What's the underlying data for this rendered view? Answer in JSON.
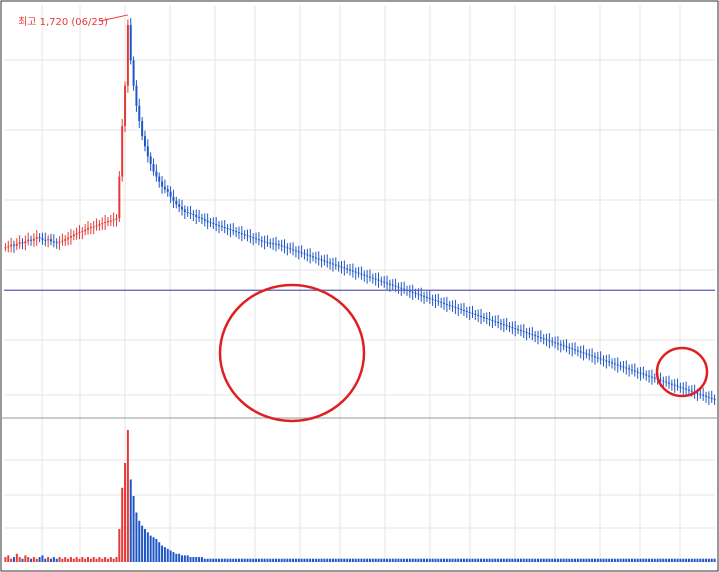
{
  "chart_data": {
    "type": "candlestick",
    "annotation": {
      "peak_label": "최고 1,720 (06/25)",
      "peak_index": 43
    },
    "series": {
      "closes": [
        1280,
        1282,
        1285,
        1283,
        1287,
        1290,
        1288,
        1292,
        1295,
        1293,
        1297,
        1300,
        1298,
        1295,
        1294,
        1296,
        1292,
        1290,
        1289,
        1291,
        1293,
        1296,
        1299,
        1302,
        1305,
        1308,
        1310,
        1312,
        1315,
        1318,
        1320,
        1321,
        1323,
        1326,
        1328,
        1330,
        1332,
        1333,
        1335,
        1338,
        1420,
        1520,
        1600,
        1720,
        1650,
        1600,
        1560,
        1530,
        1500,
        1480,
        1460,
        1445,
        1430,
        1420,
        1410,
        1400,
        1395,
        1390,
        1380,
        1372,
        1365,
        1360,
        1355,
        1350,
        1348,
        1346,
        1344,
        1340,
        1338,
        1336,
        1333,
        1330,
        1328,
        1326,
        1324,
        1322,
        1320,
        1318,
        1316,
        1314,
        1312,
        1310,
        1308,
        1306,
        1304,
        1302,
        1300,
        1298,
        1296,
        1294,
        1292,
        1290,
        1289,
        1288,
        1287,
        1286,
        1284,
        1282,
        1280,
        1278,
        1276,
        1274,
        1272,
        1270,
        1268,
        1266,
        1264,
        1262,
        1260,
        1258,
        1256,
        1254,
        1252,
        1250,
        1248,
        1246,
        1244,
        1242,
        1240,
        1238,
        1236,
        1234,
        1232,
        1230,
        1228,
        1226,
        1224,
        1222,
        1220,
        1218,
        1216,
        1214,
        1212,
        1210,
        1208,
        1206,
        1204,
        1202,
        1200,
        1198,
        1196,
        1194,
        1192,
        1190,
        1188,
        1186,
        1184,
        1182,
        1180,
        1178,
        1176,
        1174,
        1172,
        1170,
        1168,
        1166,
        1164,
        1162,
        1160,
        1158,
        1156,
        1154,
        1152,
        1150,
        1148,
        1146,
        1144,
        1142,
        1140,
        1138,
        1136,
        1134,
        1132,
        1130,
        1128,
        1126,
        1124,
        1122,
        1120,
        1118,
        1116,
        1114,
        1112,
        1110,
        1108,
        1106,
        1104,
        1102,
        1100,
        1098,
        1096,
        1094,
        1092,
        1090,
        1088,
        1086,
        1084,
        1082,
        1080,
        1078,
        1076,
        1074,
        1072,
        1070,
        1068,
        1066,
        1064,
        1062,
        1060,
        1058,
        1056,
        1054,
        1052,
        1050,
        1048,
        1046,
        1044,
        1042,
        1040,
        1038,
        1036,
        1034,
        1032,
        1030,
        1028,
        1026,
        1024,
        1022,
        1020,
        1018,
        1016,
        1014,
        1012,
        1010,
        1008,
        1006,
        1004,
        1002,
        1000,
        998,
        996,
        994,
        992,
        990,
        988,
        986,
        984,
        982,
        980,
        978
      ],
      "volumes": [
        3,
        4,
        2,
        3,
        5,
        3,
        2,
        4,
        3,
        2,
        3,
        2,
        3,
        4,
        2,
        3,
        2,
        3,
        2,
        3,
        2,
        3,
        2,
        3,
        2,
        3,
        2,
        3,
        2,
        3,
        2,
        3,
        2,
        3,
        2,
        3,
        2,
        3,
        2,
        3,
        20,
        45,
        60,
        80,
        50,
        40,
        30,
        25,
        22,
        20,
        18,
        16,
        15,
        14,
        12,
        10,
        9,
        8,
        7,
        6,
        5,
        5,
        4,
        4,
        4,
        3,
        3,
        3,
        3,
        3,
        2,
        2,
        2,
        2,
        2,
        2,
        2,
        2,
        2,
        2,
        2,
        2,
        2,
        2,
        2,
        2,
        2,
        2,
        2,
        2,
        2,
        2,
        2,
        2,
        2,
        2,
        2,
        2,
        2,
        2,
        2,
        2,
        2,
        2,
        2,
        2,
        2,
        2,
        2,
        2,
        2,
        2,
        2,
        2,
        2,
        2,
        2,
        2,
        2,
        2,
        2,
        2,
        2,
        2,
        2,
        2,
        2,
        2,
        2,
        2,
        2,
        2,
        2,
        2,
        2,
        2,
        2,
        2,
        2,
        2,
        2,
        2,
        2,
        2,
        2,
        2,
        2,
        2,
        2,
        2,
        2,
        2,
        2,
        2,
        2,
        2,
        2,
        2,
        2,
        2,
        2,
        2,
        2,
        2,
        2,
        2,
        2,
        2,
        2,
        2,
        2,
        2,
        2,
        2,
        2,
        2,
        2,
        2,
        2,
        2,
        2,
        2,
        2,
        2,
        2,
        2,
        2,
        2,
        2,
        2,
        2,
        2,
        2,
        2,
        2,
        2,
        2,
        2,
        2,
        2,
        2,
        2,
        2,
        2,
        2,
        2,
        2,
        2,
        2,
        2,
        2,
        2,
        2,
        2,
        2,
        2,
        2,
        2,
        2,
        2,
        2,
        2,
        2,
        2,
        2,
        2,
        2,
        2,
        2,
        2,
        2,
        2,
        2,
        2,
        2,
        2,
        2,
        2,
        2,
        2,
        2,
        2,
        2,
        2,
        2,
        2,
        2,
        2,
        2,
        2
      ]
    },
    "colors": {
      "up": "#e53935",
      "down": "#1e56c8",
      "support_line": "#5b5bb5",
      "grid": "#e6e6e6",
      "circle": "#e02020"
    },
    "support_level": 1195
  }
}
